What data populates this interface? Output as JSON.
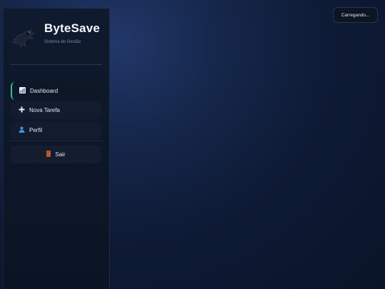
{
  "brand": {
    "title": "ByteSave",
    "subtitle": "Sistema de Gestão",
    "logo_icon": "raptor-logo-icon"
  },
  "nav": {
    "items": [
      {
        "label": "Dashboard",
        "icon": "bar-chart-icon",
        "active": true
      },
      {
        "label": "Nova Tarefa",
        "icon": "plus-icon",
        "active": false
      },
      {
        "label": "Perfil",
        "icon": "user-icon",
        "active": false
      }
    ],
    "logout_label": "Sair",
    "logout_icon": "door-icon"
  },
  "status": {
    "text": "Carregando..."
  },
  "colors": {
    "accent": "#2fbf8f",
    "sidebar_bg": "#0f1a2e",
    "page_bg": "#16284d"
  }
}
